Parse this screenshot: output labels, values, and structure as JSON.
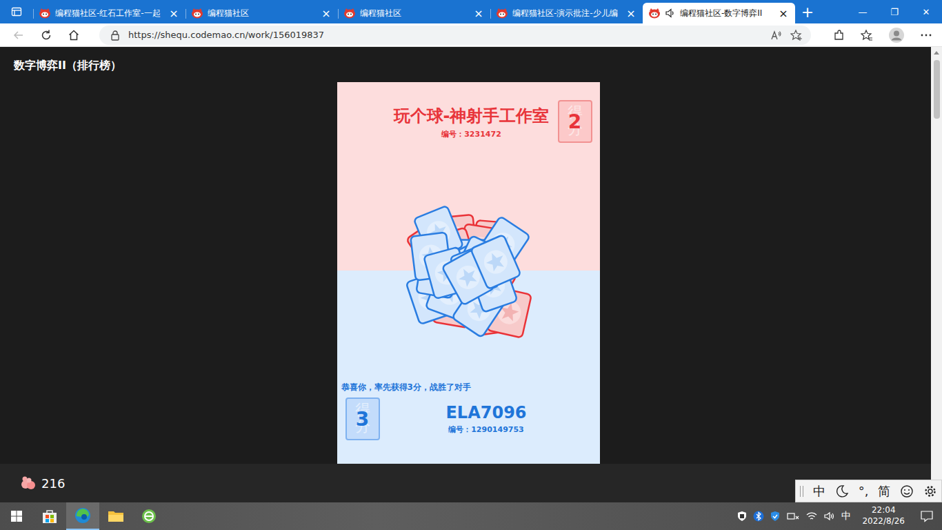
{
  "browser": {
    "tabs": [
      {
        "label": "编程猫社区-红石工作室-一起",
        "selected": false,
        "playing": false
      },
      {
        "label": "编程猫社区",
        "selected": false,
        "playing": false
      },
      {
        "label": "编程猫社区",
        "selected": false,
        "playing": false
      },
      {
        "label": "编程猫社区-演示批注-少儿编",
        "selected": false,
        "playing": false
      },
      {
        "label": "编程猫社区-数字博弈II",
        "selected": true,
        "playing": true
      }
    ],
    "tab_close": "×",
    "new_tab": "+",
    "window_controls": [
      "—",
      "❐",
      "✕"
    ],
    "url": "https://shequ.codemao.cn/work/156019837"
  },
  "page": {
    "title": "数字博弈II（排行榜）",
    "likes": "216"
  },
  "game": {
    "opponent": {
      "name": "玩个球-神射手工作室",
      "id_label": "编号：3231472",
      "score": "2",
      "score_label": "得分"
    },
    "player": {
      "name": "ELA7096",
      "id_label": "编号：1290149753",
      "score": "3",
      "score_label": "得分"
    },
    "message": "恭喜你，率先获得3分，战胜了对手",
    "pile": {
      "red": 10,
      "blue": 20
    }
  },
  "ime": [
    {
      "kind": "text",
      "label": "中"
    },
    {
      "kind": "moon"
    },
    {
      "kind": "text",
      "label": "°,"
    },
    {
      "kind": "text",
      "label": "简"
    },
    {
      "kind": "smiley"
    },
    {
      "kind": "gear"
    }
  ],
  "taskbar": {
    "tray_lang": "中",
    "time": "22:04",
    "date": "2022/8/26"
  }
}
